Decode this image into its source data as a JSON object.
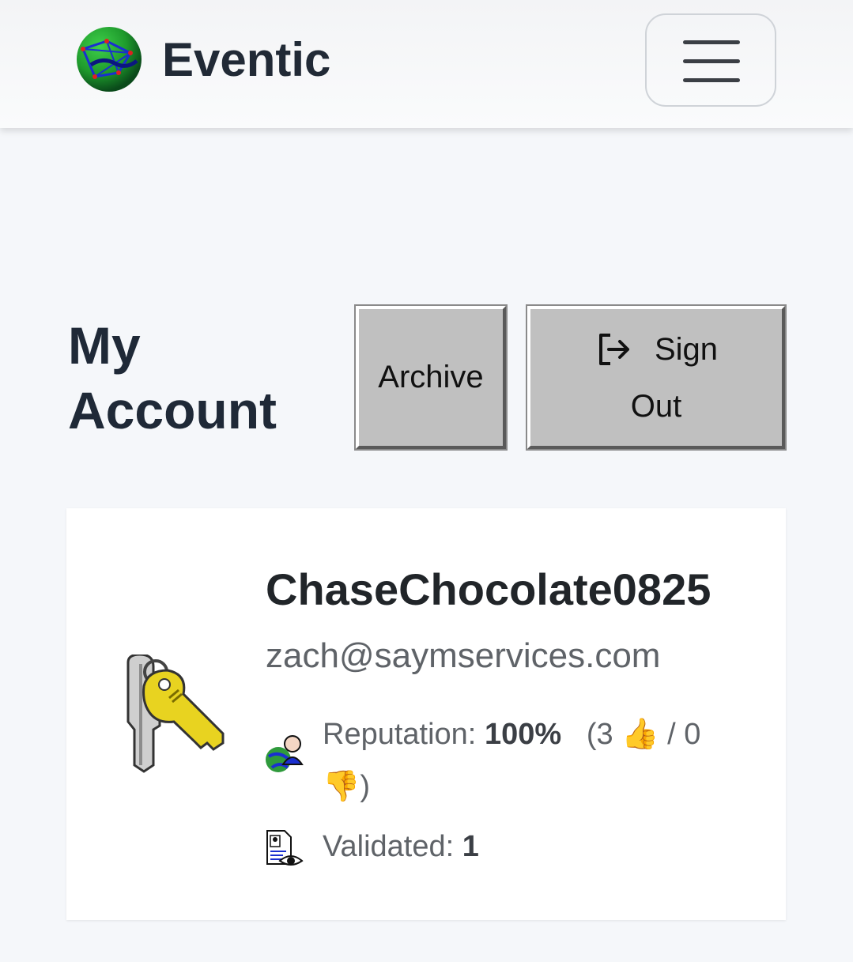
{
  "navbar": {
    "brand_name": "Eventic",
    "logo_icon": "globe-network-icon",
    "menu_icon": "hamburger-menu-icon"
  },
  "page": {
    "title_line1": "My",
    "title_line2": "Account",
    "archive_label": "Archive",
    "signout_label_line1": "Sign",
    "signout_label_line2": "Out",
    "signout_icon": "box-arrow-right-icon"
  },
  "profile": {
    "avatar_icon": "keys-icon",
    "username": "ChaseChocolate0825",
    "email": "zach@saymservices.com",
    "reputation_label": "Reputation:",
    "reputation_value": "100%",
    "thumbs_up_count": "(3",
    "separator": "/ 0",
    "closing": ")",
    "validated_label": "Validated:",
    "validated_value": "1"
  },
  "colors": {
    "background": "#f5f7fa",
    "button_face": "#c0c0c0",
    "text_dark": "#1f2937",
    "text_muted": "#5f6368"
  }
}
